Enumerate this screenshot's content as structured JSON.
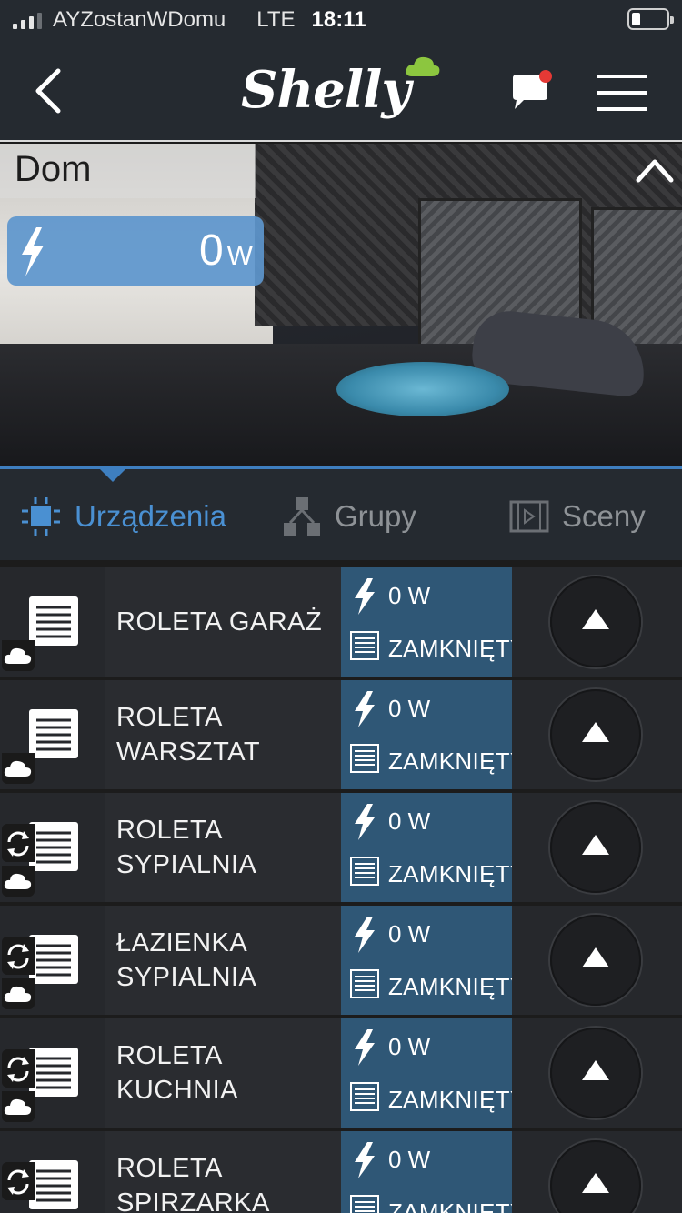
{
  "status_bar": {
    "carrier": "AYZostanWDomu",
    "network": "LTE",
    "time": "18:11"
  },
  "nav": {
    "logo_text": "Shelly"
  },
  "hero": {
    "room_name": "Dom",
    "power_value": "0",
    "power_unit": "W"
  },
  "tabs": [
    {
      "label": "Urządzenia",
      "active": true
    },
    {
      "label": "Grupy",
      "active": false
    },
    {
      "label": "Sceny",
      "active": false
    }
  ],
  "devices": [
    {
      "name": "ROLETA GARAŻ",
      "power": "0 W",
      "state": "ZAMKNIĘTY"
    },
    {
      "name": "ROLETA WARSZTAT",
      "power": "0 W",
      "state": "ZAMKNIĘTY"
    },
    {
      "name": "ROLETA SYPIALNIA",
      "power": "0 W",
      "state": "ZAMKNIĘTY"
    },
    {
      "name": "ŁAZIENKA SYPIALNIA",
      "power": "0 W",
      "state": "ZAMKNIĘTY"
    },
    {
      "name": "ROLETA KUCHNIA",
      "power": "0 W",
      "state": "ZAMKNIĘTY"
    },
    {
      "name": "ROLETA SPIRZARKA",
      "power": "0 W",
      "state": "ZAMKNIĘTY"
    }
  ],
  "colors": {
    "accent": "#4a90d2",
    "status_bg": "#2f5776",
    "power_badge": "#5d96cd",
    "notification_dot": "#e53935"
  }
}
